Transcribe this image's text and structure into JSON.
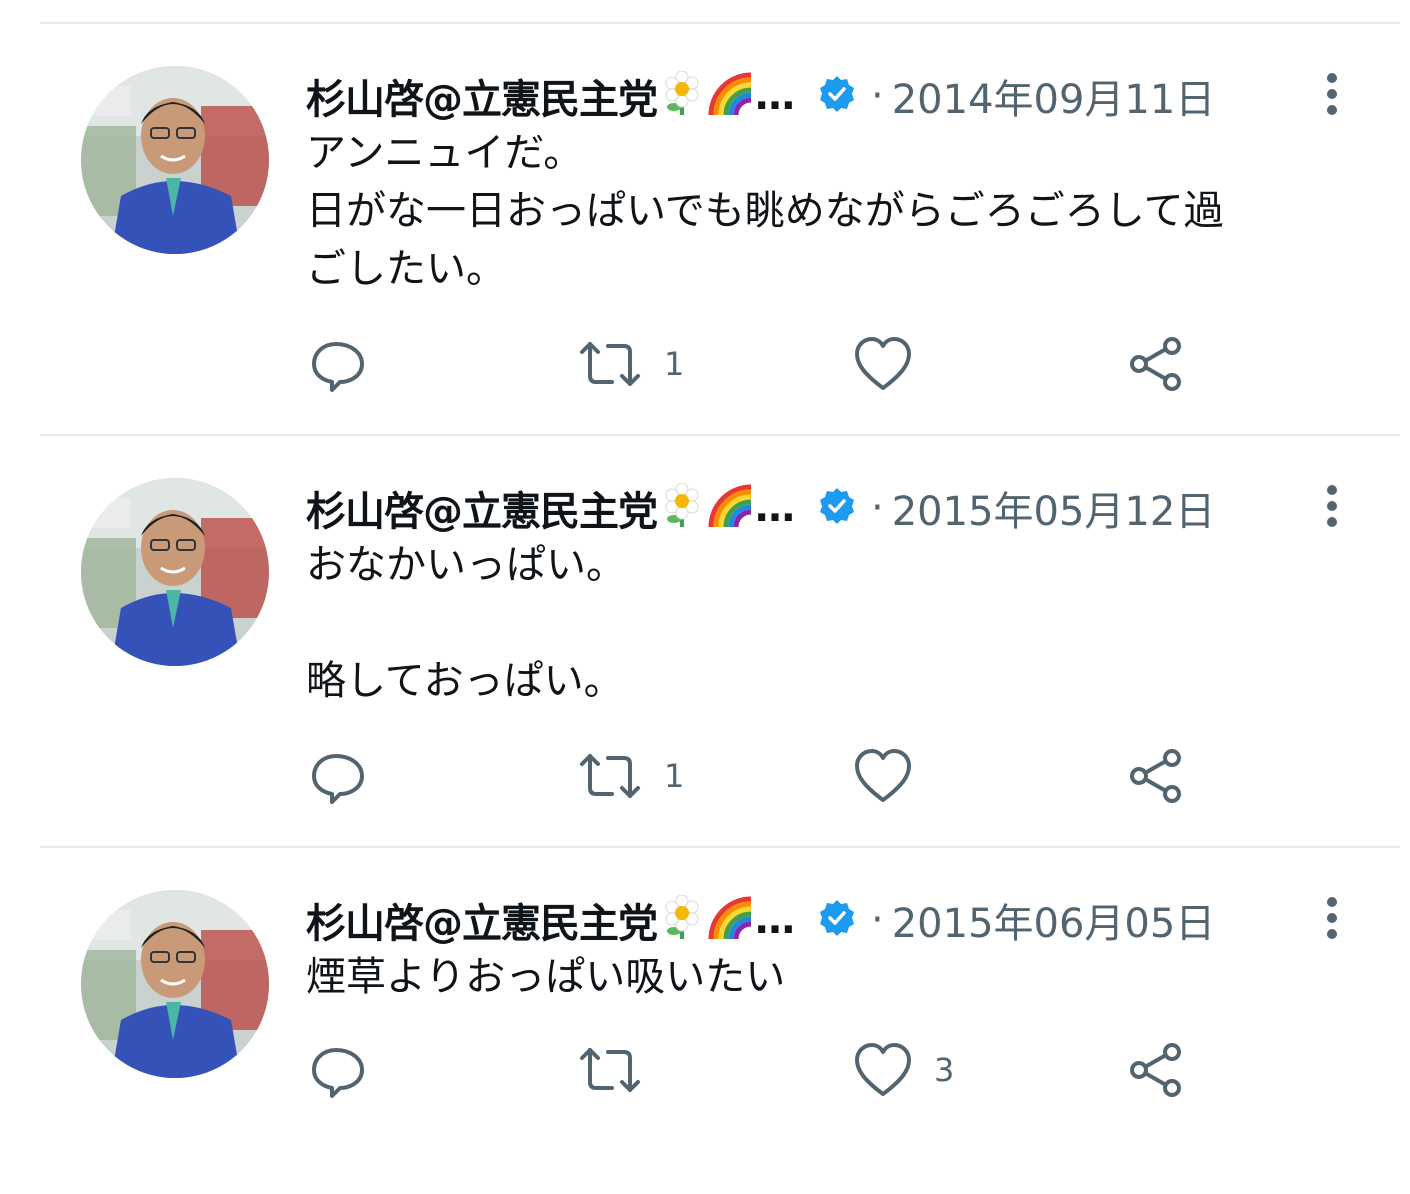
{
  "tweets": [
    {
      "display_name": "杉山啓@立憲民主党",
      "truncation": "…",
      "separator": "·",
      "date": "2014年09月11日",
      "text": "アンニュイだ。\n日がな一日おっぱいでも眺めながらごろごろして過\nごしたい。",
      "counts": {
        "reply": "",
        "retweet": "1",
        "like": "",
        "share": ""
      }
    },
    {
      "display_name": "杉山啓@立憲民主党",
      "truncation": "…",
      "separator": "·",
      "date": "2015年05月12日",
      "text": "おなかいっぱい。\n\n略しておっぱい。",
      "counts": {
        "reply": "",
        "retweet": "1",
        "like": "",
        "share": ""
      }
    },
    {
      "display_name": "杉山啓@立憲民主党",
      "truncation": "…",
      "separator": "·",
      "date": "2015年06月05日",
      "text": "煙草よりおっぱい吸いたい",
      "counts": {
        "reply": "",
        "retweet": "",
        "like": "3",
        "share": ""
      }
    }
  ],
  "icons": [
    "reply-icon",
    "retweet-icon",
    "like-icon",
    "share-icon",
    "verified-badge-icon",
    "more-options-icon",
    "flower-emoji",
    "rainbow-emoji"
  ],
  "colors": {
    "action_gray": "#536471",
    "verified_blue": "#1d9bf0",
    "divider": "#e6e9eb"
  }
}
